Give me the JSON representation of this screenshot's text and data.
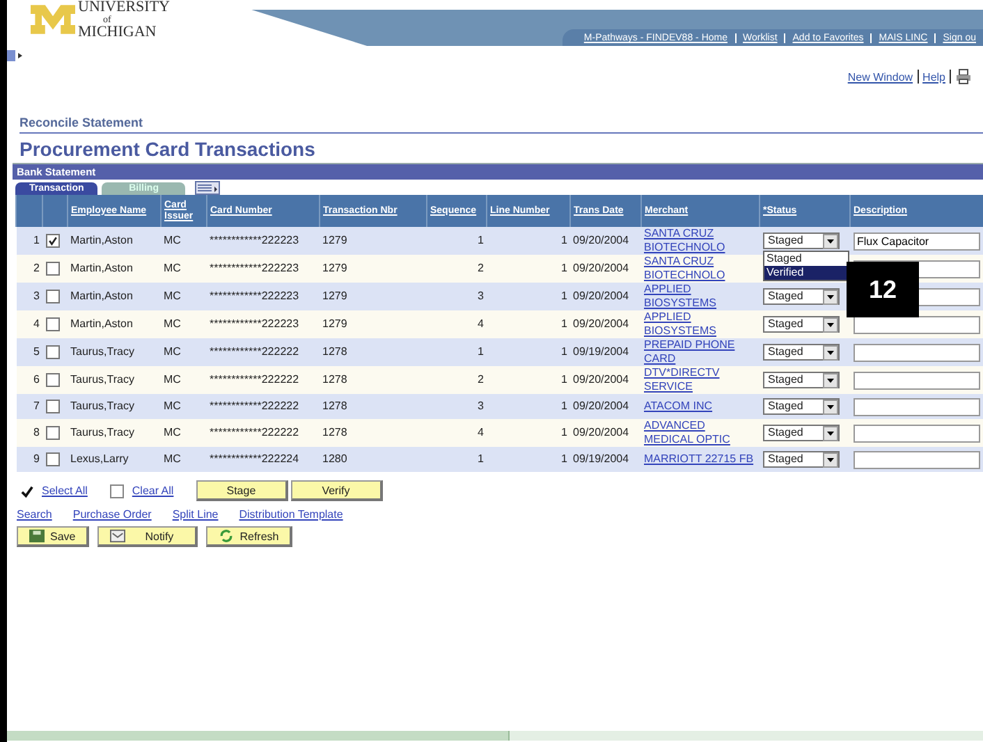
{
  "logo": {
    "line_1": "UNIVERSITY",
    "line_2": "of",
    "line_3": "MICHIGAN"
  },
  "nav_links": [
    "M-Pathways - FINDEV88 - Home",
    "Worklist",
    "Add to Favorites",
    "MAIS LINC",
    "Sign ou"
  ],
  "page_links": [
    "New Window",
    "Help"
  ],
  "breadcrumb": "Reconcile Statement",
  "title": "Procurement Card Transactions",
  "section": "Bank Statement",
  "tabs": [
    {
      "label": "Transaction",
      "selected": true
    },
    {
      "label": "Billing",
      "selected": false
    }
  ],
  "table": {
    "columns": [
      "",
      "",
      "Employee Name",
      "Card Issuer",
      "Card Number",
      "Transaction Nbr",
      "Sequence",
      "Line Number",
      "Trans Date",
      "Merchant",
      "*Status",
      "Description"
    ],
    "rows": [
      {
        "num": "1",
        "checked": true,
        "employee": "Martin,Aston",
        "issuer": "MC",
        "card": "************222223",
        "trans_nbr": "1279",
        "sequence": "1",
        "line": "1",
        "date": "09/20/2004",
        "merchant": "SANTA CRUZ BIOTECHNOLO",
        "status": "Staged",
        "description": "Flux Capacitor",
        "status_menu": [
          {
            "label": "Staged",
            "selected": false
          },
          {
            "label": "Verified",
            "selected": true
          }
        ]
      },
      {
        "num": "2",
        "checked": false,
        "employee": "Martin,Aston",
        "issuer": "MC",
        "card": "************222223",
        "trans_nbr": "1279",
        "sequence": "2",
        "line": "1",
        "date": "09/20/2004",
        "merchant": "SANTA CRUZ BIOTECHNOLO"
      },
      {
        "num": "3",
        "checked": false,
        "employee": "Martin,Aston",
        "issuer": "MC",
        "card": "************222223",
        "trans_nbr": "1279",
        "sequence": "3",
        "line": "1",
        "date": "09/20/2004",
        "merchant": "APPLIED BIOSYSTEMS",
        "status": "Staged"
      },
      {
        "num": "4",
        "checked": false,
        "employee": "Martin,Aston",
        "issuer": "MC",
        "card": "************222223",
        "trans_nbr": "1279",
        "sequence": "4",
        "line": "1",
        "date": "09/20/2004",
        "merchant": "APPLIED BIOSYSTEMS",
        "status": "Staged"
      },
      {
        "num": "5",
        "checked": false,
        "employee": "Taurus,Tracy",
        "issuer": "MC",
        "card": "************222222",
        "trans_nbr": "1278",
        "sequence": "1",
        "line": "1",
        "date": "09/19/2004",
        "merchant": "PREPAID PHONE CARD",
        "status": "Staged"
      },
      {
        "num": "6",
        "checked": false,
        "employee": "Taurus,Tracy",
        "issuer": "MC",
        "card": "************222222",
        "trans_nbr": "1278",
        "sequence": "2",
        "line": "1",
        "date": "09/20/2004",
        "merchant": "DTV*DIRECTV SERVICE",
        "status": "Staged"
      },
      {
        "num": "7",
        "checked": false,
        "employee": "Taurus,Tracy",
        "issuer": "MC",
        "card": "************222222",
        "trans_nbr": "1278",
        "sequence": "3",
        "line": "1",
        "date": "09/20/2004",
        "merchant": "ATACOM INC",
        "status": "Staged"
      },
      {
        "num": "8",
        "checked": false,
        "employee": "Taurus,Tracy",
        "issuer": "MC",
        "card": "************222222",
        "trans_nbr": "1278",
        "sequence": "4",
        "line": "1",
        "date": "09/20/2004",
        "merchant": "ADVANCED MEDICAL OPTIC",
        "status": "Staged"
      },
      {
        "num": "9",
        "checked": false,
        "employee": "Lexus,Larry",
        "issuer": "MC",
        "card": "************222224",
        "trans_nbr": "1280",
        "sequence": "1",
        "line": "1",
        "date": "09/19/2004",
        "merchant": "MARRIOTT 22715 FB",
        "status": "Staged"
      }
    ]
  },
  "callout": "12",
  "select_controls": [
    {
      "label": "Select All",
      "checked": true
    },
    {
      "label": "Clear All",
      "checked": false
    }
  ],
  "row_buttons": [
    "Stage",
    "Verify"
  ],
  "links": [
    "Search",
    "Purchase Order",
    "Split Line",
    "Distribution Template"
  ],
  "buttons": [
    {
      "label": "Save",
      "kind": "save"
    },
    {
      "label": "Notify",
      "kind": "notify"
    },
    {
      "label": "Refresh",
      "kind": "refresh"
    }
  ]
}
